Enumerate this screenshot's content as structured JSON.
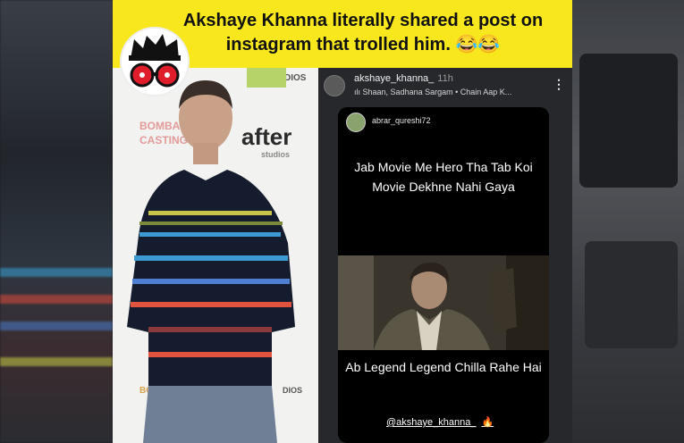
{
  "post": {
    "headline_line1": "Akshaye Khanna literally shared a post on",
    "headline_line2": "instagram that trolled him.",
    "headline_emoji": "😂😂"
  },
  "photo_backdrop": {
    "wm1": "STUDIOS",
    "wm2": "BOMBAY",
    "wm3": "CASTING",
    "wm4": "after",
    "wm5": "studios",
    "wm6": "DIOS",
    "wm7": "BO"
  },
  "instagram": {
    "username": "akshaye_khanna_",
    "time": "11h",
    "music_icon": "audio-bars-icon",
    "song": "Shaan, Sadhana Sargam • Chain Aap K...",
    "more_icon": "more-vertical-icon",
    "more_glyph": "⋮",
    "repost": {
      "username": "abrar_qureshi72",
      "text1_line1": "Jab Movie Me Hero Tha Tab Koi",
      "text1_line2": "Movie Dekhne Nahi Gaya",
      "text2": "Ab Legend Legend Chilla Rahe Hai",
      "mention": "@akshaye_khanna_",
      "mention_emoji": "🔥"
    }
  },
  "colors": {
    "header_bg": "#f8e71c",
    "ig_bg": "#26282c",
    "logo_red": "#e01e2b"
  }
}
